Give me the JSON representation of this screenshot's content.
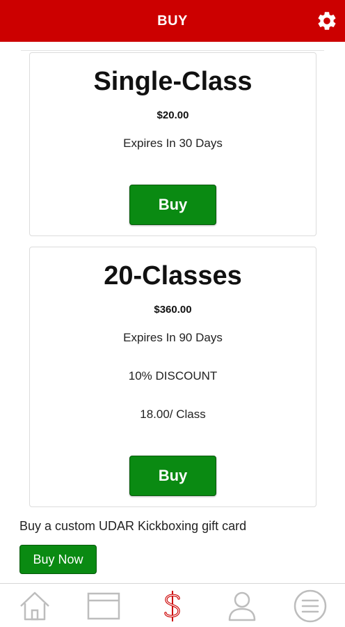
{
  "header": {
    "title": "BUY",
    "settings_icon": "gear-icon",
    "background": "#cc0000"
  },
  "packages": [
    {
      "title": "Single-Class",
      "price": "$20.00",
      "details": [
        "Expires In 30 Days"
      ],
      "button_label": "Buy"
    },
    {
      "title": "20-Classes",
      "price": "$360.00",
      "details": [
        "Expires In 90 Days",
        "10% DISCOUNT",
        "18.00/ Class"
      ],
      "button_label": "Buy"
    }
  ],
  "gift": {
    "text": "Buy a custom UDAR Kickboxing gift card",
    "button_label": "Buy Now"
  },
  "nav": {
    "items": [
      {
        "icon": "home-icon",
        "active": false
      },
      {
        "icon": "calendar-icon",
        "active": false
      },
      {
        "icon": "dollar-icon",
        "active": true
      },
      {
        "icon": "user-icon",
        "active": false
      },
      {
        "icon": "menu-icon",
        "active": false
      }
    ]
  },
  "colors": {
    "accent": "#cc0000",
    "button": "#0a8a12",
    "nav_inactive": "#bdbdbd"
  }
}
